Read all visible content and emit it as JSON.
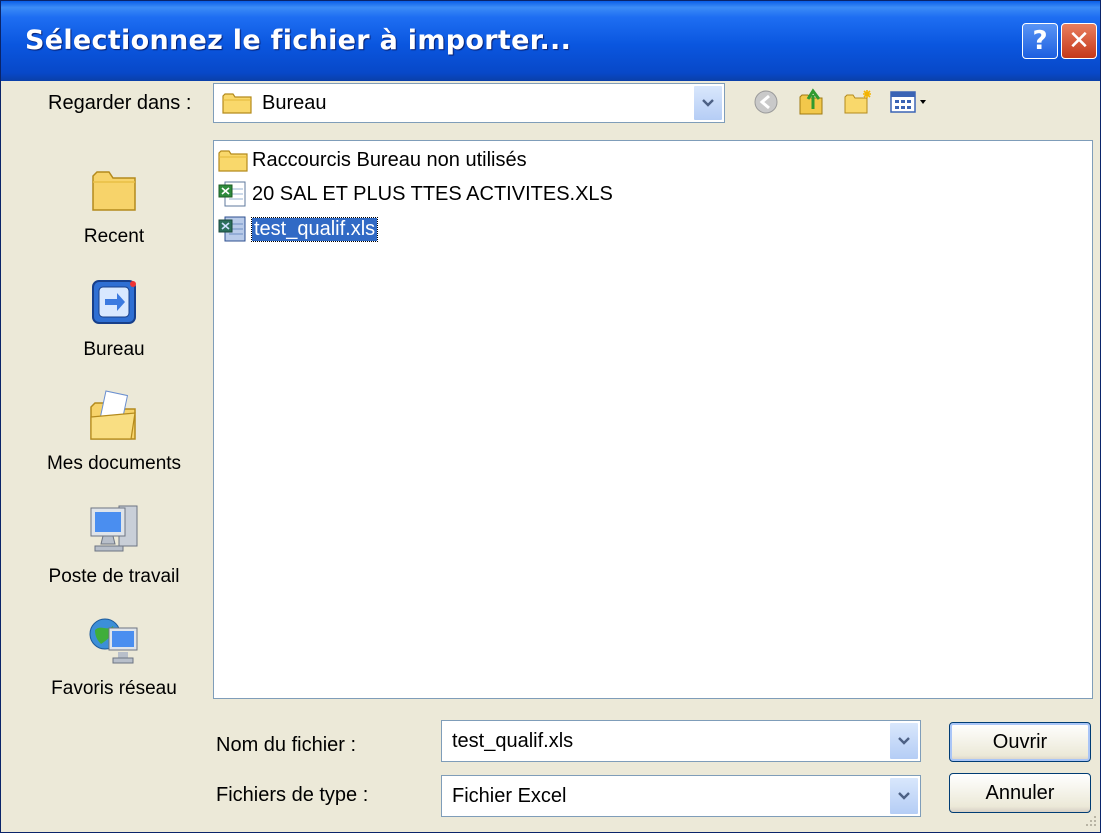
{
  "window": {
    "title": "Sélectionnez le fichier à importer..."
  },
  "titlebar_buttons": {
    "help": "?",
    "close": "✕"
  },
  "lookin": {
    "label": "Regarder dans :",
    "value": "Bureau"
  },
  "toolbar": {
    "icons": [
      "back-icon",
      "up-folder-icon",
      "new-folder-icon",
      "view-menu-icon"
    ]
  },
  "places": [
    {
      "label": "Recent",
      "icon": "recent-folder-icon"
    },
    {
      "label": "Bureau",
      "icon": "desktop-icon"
    },
    {
      "label": "Mes documents",
      "icon": "my-documents-icon"
    },
    {
      "label": "Poste de travail",
      "icon": "my-computer-icon"
    },
    {
      "label": "Favoris réseau",
      "icon": "network-places-icon"
    }
  ],
  "files": [
    {
      "name": "Raccourcis Bureau non utilisés",
      "type": "folder",
      "selected": false
    },
    {
      "name": "20 SAL ET PLUS TTES ACTIVITES.XLS",
      "type": "excel",
      "selected": false
    },
    {
      "name": "test_qualif.xls",
      "type": "excel",
      "selected": true
    }
  ],
  "filename": {
    "label": "Nom du fichier :",
    "value": "test_qualif.xls"
  },
  "filetype": {
    "label": "Fichiers de type :",
    "value": "Fichier Excel"
  },
  "buttons": {
    "open": "Ouvrir",
    "cancel": "Annuler"
  }
}
